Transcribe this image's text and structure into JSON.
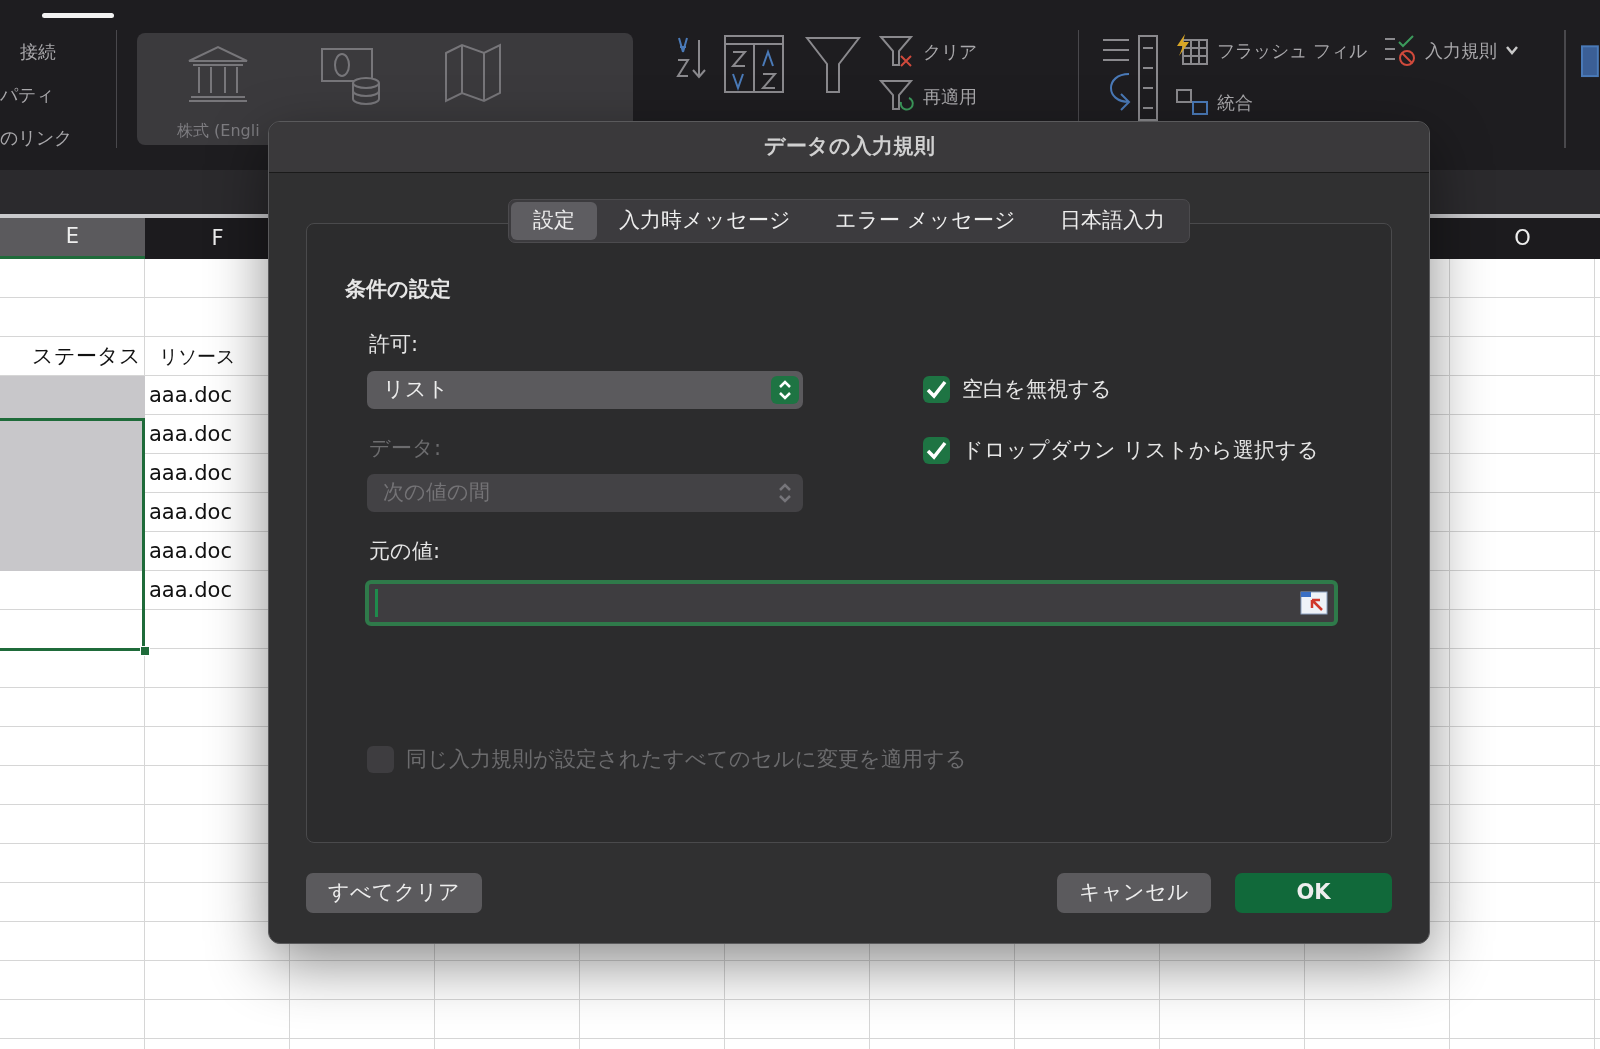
{
  "ribbon": {
    "connections": [
      "接続",
      "パティ",
      "のリンク"
    ],
    "data_types": [
      {
        "label": "株式 (Engli"
      }
    ],
    "sort_filter": [
      "クリア",
      "再適用"
    ],
    "data_tools": [
      {
        "label": "フラッシュ フィル",
        "kind": "plain"
      },
      {
        "label": "入力規則",
        "kind": "menu"
      },
      {
        "label": "統合",
        "kind": "plain"
      }
    ]
  },
  "sheet": {
    "columns": [
      {
        "label": "E",
        "selected": true
      },
      {
        "label": "F",
        "selected": false
      },
      {
        "label": "O",
        "selected": false
      }
    ],
    "rows": [
      {
        "status": "ステータス",
        "resource": "リソース",
        "highlighted": false
      },
      {
        "resource": "aaa.doc",
        "highlighted": true
      },
      {
        "resource": "aaa.doc",
        "highlighted": true
      },
      {
        "resource": "aaa.doc",
        "highlighted": true
      },
      {
        "resource": "aaa.doc",
        "highlighted": true
      },
      {
        "resource": "aaa.doc",
        "highlighted": true
      },
      {
        "resource": "aaa.doc",
        "highlighted": false
      }
    ]
  },
  "dialog": {
    "title": "データの入力規則",
    "tabs": [
      {
        "label": "設定",
        "selected": true
      },
      {
        "label": "入力時メッセージ",
        "selected": false
      },
      {
        "label": "エラー メッセージ",
        "selected": false
      },
      {
        "label": "日本語入力",
        "selected": false
      }
    ],
    "section_title": "条件の設定",
    "allow": {
      "label": "許可:",
      "value": "リスト",
      "disabled": false
    },
    "data": {
      "label": "データ:",
      "value": "次の値の間",
      "disabled": true
    },
    "source": {
      "label": "元の値:"
    },
    "options": [
      {
        "label": "空白を無視する",
        "checked": true
      },
      {
        "label": "ドロップダウン リストから選択する",
        "checked": true
      }
    ],
    "apply_all": {
      "label": "同じ入力規則が設定されたすべてのセルに変更を適用する",
      "checked": false,
      "disabled": true
    },
    "buttons": [
      {
        "label": "すべてクリア",
        "kind": "secondary"
      },
      {
        "label": "キャンセル",
        "kind": "secondary"
      },
      {
        "label": "OK",
        "kind": "default"
      }
    ]
  }
}
